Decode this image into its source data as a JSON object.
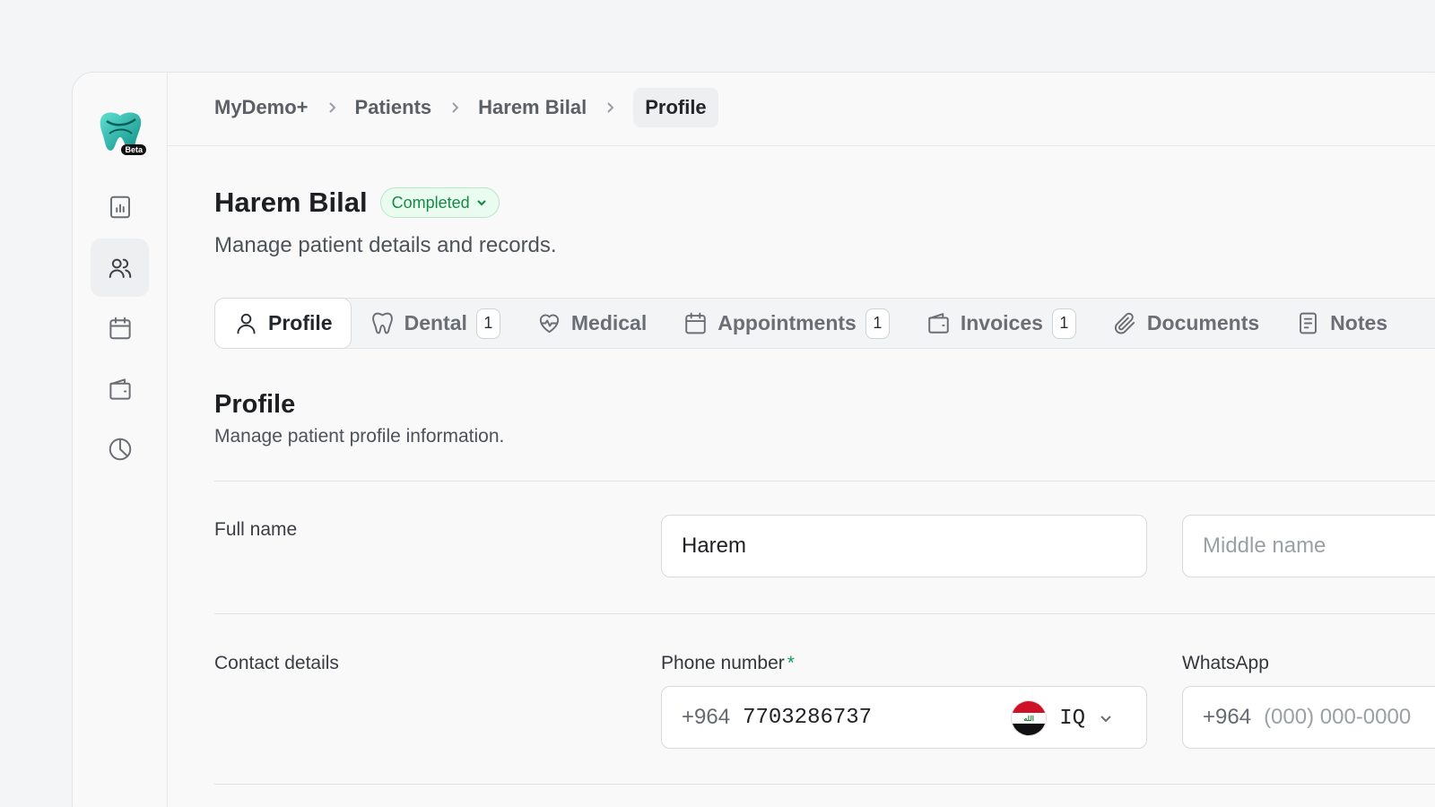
{
  "breadcrumb": [
    "MyDemo+",
    "Patients",
    "Harem Bilal",
    "Profile"
  ],
  "logo": {
    "badge": "Beta"
  },
  "sidebar": {
    "items": [
      {
        "icon": "chart-icon",
        "active": false
      },
      {
        "icon": "users-icon",
        "active": true
      },
      {
        "icon": "calendar-icon",
        "active": false
      },
      {
        "icon": "wallet-icon",
        "active": false
      },
      {
        "icon": "pie-chart-icon",
        "active": false
      }
    ]
  },
  "header": {
    "title": "Harem Bilal",
    "status": "Completed",
    "subtitle": "Manage patient details and records."
  },
  "tabs": [
    {
      "label": "Profile",
      "icon": "user-icon",
      "count": null,
      "active": true
    },
    {
      "label": "Dental",
      "icon": "tooth-icon",
      "count": "1",
      "active": false
    },
    {
      "label": "Medical",
      "icon": "heart-pulse-icon",
      "count": null,
      "active": false
    },
    {
      "label": "Appointments",
      "icon": "calendar-icon",
      "count": "1",
      "active": false
    },
    {
      "label": "Invoices",
      "icon": "wallet-icon",
      "count": "1",
      "active": false
    },
    {
      "label": "Documents",
      "icon": "paperclip-icon",
      "count": null,
      "active": false
    },
    {
      "label": "Notes",
      "icon": "note-icon",
      "count": null,
      "active": false
    }
  ],
  "section": {
    "title": "Profile",
    "subtitle": "Manage patient profile information."
  },
  "form": {
    "full_name_label": "Full name",
    "first_name_value": "Harem",
    "middle_name_placeholder": "Middle name",
    "contact_label": "Contact details",
    "phone_label": "Phone number",
    "phone_required": "*",
    "phone_prefix": "+964",
    "phone_value": "7703286737",
    "phone_country": "IQ",
    "whatsapp_label": "WhatsApp",
    "whatsapp_prefix": "+964",
    "whatsapp_placeholder": "(000) 000-0000"
  },
  "colors": {
    "accent_green": "#168a45",
    "status_bg": "#eafbf0",
    "brand_teal": "#1bb5a8"
  }
}
